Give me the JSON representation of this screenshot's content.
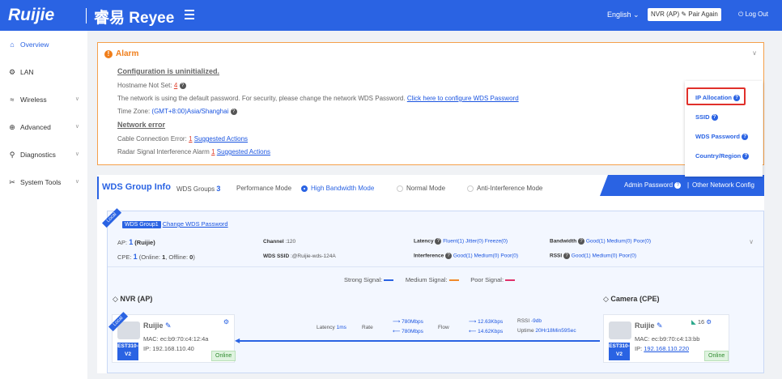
{
  "header": {
    "brand": "Ruijie",
    "product": "Reyee",
    "product_prefix": "睿易",
    "language": "English",
    "mode_label": "NVR (AP)",
    "pair_again": "Pair Again",
    "logout": "Log Out"
  },
  "sidebar": {
    "items": [
      {
        "label": "Overview",
        "icon": "home-icon"
      },
      {
        "label": "LAN",
        "icon": "gear-icon"
      },
      {
        "label": "Wireless",
        "icon": "wifi-icon"
      },
      {
        "label": "Advanced",
        "icon": "globe-icon"
      },
      {
        "label": "Diagnostics",
        "icon": "diagnostics-icon"
      },
      {
        "label": "System Tools",
        "icon": "tools-icon"
      }
    ]
  },
  "alarm": {
    "title": "Alarm",
    "config_heading": "Configuration is uninitialized.",
    "hostname_label": "Hostname Not Set:",
    "hostname_count": "4",
    "wds_pwd_text": "The network is using the default password. For security, please change the network WDS Password.",
    "wds_pwd_link": "Click here to configure WDS Password",
    "timezone_label": "Time Zone:",
    "timezone_value": "(GMT+8:00)Asia/Shanghai",
    "network_heading": "Network error",
    "cable_label": "Cable Connection Error:",
    "cable_count": "1",
    "cable_link": "Suggested Actions",
    "radar_label": "Radar Signal Interference Alarm",
    "radar_count": "1",
    "radar_link": "Suggested Actions"
  },
  "popup": {
    "items": [
      "IP Allocation",
      "SSID",
      "WDS Password",
      "Country/Region"
    ]
  },
  "wds": {
    "title": "WDS Group Info",
    "groups_label": "WDS Groups",
    "groups_count": "3",
    "perf_label": "Performance Mode",
    "modes": [
      "High Bandwidth Mode",
      "Normal Mode",
      "Anti-Interference Mode"
    ],
    "admin_password": "Admin Password",
    "other_config": "Other Network Config",
    "group": {
      "ribbon": "Local",
      "name": "WDS Group1",
      "change_pwd": "Change WDS Password",
      "ap_label": "AP:",
      "ap_count": "1",
      "ap_brand": "(Ruijie)",
      "cpe_label": "CPE:",
      "cpe_count": "1",
      "cpe_online_label": "(Online:",
      "cpe_online": "1",
      "cpe_offline_label": ", Offline:",
      "cpe_offline": "0",
      "cpe_close": ")",
      "channel_label": "Channel",
      "channel_value": ":120",
      "ssid_label": "WDS SSID",
      "ssid_value": ":@Ruijie-wds-124A",
      "latency_label": "Latency",
      "latency_values": [
        "Fluent(1)",
        "Jitter(0)",
        "Freeze(0)"
      ],
      "interference_label": "Interference",
      "interference_values": [
        "Good(1)",
        "Medium(0)",
        "Poor(0)"
      ],
      "bandwidth_label": "Bandwidth",
      "bandwidth_values": [
        "Good(1)",
        "Medium(0)",
        "Poor(0)"
      ],
      "rssi_label": "RSSI",
      "rssi_values": [
        "Good(1)",
        "Medium(0)",
        "Poor(0)"
      ],
      "legend": [
        {
          "label": "Strong Signal:",
          "color": "#2a63e3"
        },
        {
          "label": "Medium Signal:",
          "color": "#f08a2c"
        },
        {
          "label": "Poor Signal:",
          "color": "#e0306a"
        }
      ],
      "nvr": {
        "section": "NVR (AP)",
        "ribbon": "Local",
        "name": "Ruijie",
        "mac_label": "MAC:",
        "mac": "ec:b9:70:c4:12:4a",
        "ip_label": "IP:",
        "ip": "192.168.110.40",
        "model": "EST310-V2",
        "status": "Online"
      },
      "link": {
        "latency_label": "Latency",
        "latency_value": "1ms",
        "rate_label": "Rate",
        "rate_up": "780Mbps",
        "rate_down": "780Mbps",
        "flow_label": "Flow",
        "flow_up": "12.63Kbps",
        "flow_down": "14.62Kbps",
        "rssi_label": "RSSI",
        "rssi_value": "-9db",
        "uptime_label": "Uptime",
        "uptime_value": "20Hr18Min59Sec"
      },
      "camera": {
        "section": "Camera (CPE)",
        "name": "Ruijie",
        "mac_label": "MAC:",
        "mac": "ec:b9:70:c4:13:bb",
        "ip_label": "IP:",
        "ip": "192.168.110.220",
        "model": "EST310-V2",
        "status": "Online",
        "clients": "16"
      }
    }
  }
}
